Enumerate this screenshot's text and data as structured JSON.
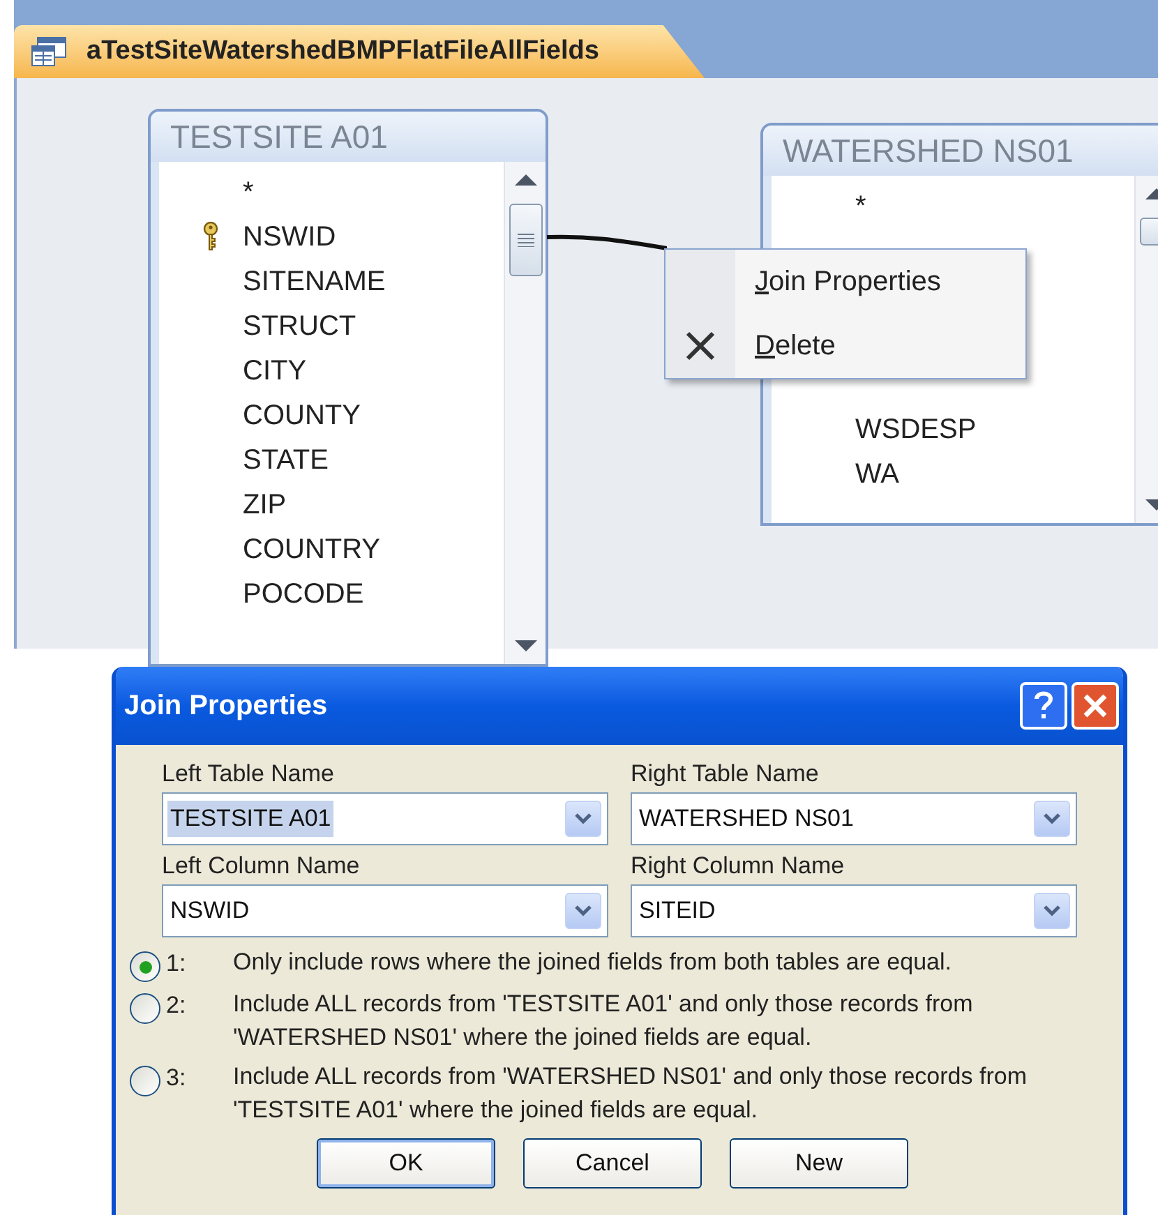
{
  "document_tab": {
    "title": "aTestSiteWatershedBMPFlatFileAllFields",
    "selected": true
  },
  "tables": [
    {
      "title": "TESTSITE A01",
      "fields": [
        {
          "name": "*",
          "kind": "all"
        },
        {
          "name": "NSWID",
          "kind": "key"
        },
        {
          "name": "SITENAME",
          "kind": "field"
        },
        {
          "name": "STRUCT",
          "kind": "field"
        },
        {
          "name": "CITY",
          "kind": "field"
        },
        {
          "name": "COUNTY",
          "kind": "field"
        },
        {
          "name": "STATE",
          "kind": "field"
        },
        {
          "name": "ZIP",
          "kind": "field"
        },
        {
          "name": "COUNTRY",
          "kind": "field"
        },
        {
          "name": "POCODE",
          "kind": "field"
        }
      ]
    },
    {
      "title": "WATERSHED NS01",
      "fields": [
        {
          "name": "*",
          "kind": "all"
        },
        {
          "kind": "covered"
        },
        {
          "kind": "covered"
        },
        {
          "kind": "covered"
        },
        {
          "kind": "covered"
        },
        {
          "name": "WSDESP",
          "kind": "field"
        },
        {
          "name": "WA",
          "kind": "field"
        }
      ]
    }
  ],
  "context_menu": {
    "items": [
      {
        "label": "Join Properties",
        "kind": "plain"
      },
      {
        "label": "Delete",
        "kind": "delete"
      }
    ]
  },
  "dialog": {
    "title": "Join Properties",
    "fields": [
      {
        "label": "Left Table Name",
        "value": "TESTSITE A01",
        "selected": true
      },
      {
        "label": "Right Table Name",
        "value": "WATERSHED NS01",
        "selected": false
      },
      {
        "label": "Left Column Name",
        "value": "NSWID",
        "selected": false
      },
      {
        "label": "Right Column Name",
        "value": "SITEID",
        "selected": false
      }
    ],
    "options": [
      {
        "number": "1:",
        "text": "Only include rows where the joined fields from both tables are equal.",
        "selected": true
      },
      {
        "number": "2:",
        "text": "Include ALL records from 'TESTSITE A01' and only those records from 'WATERSHED NS01' where the joined fields are equal.",
        "selected": false
      },
      {
        "number": "3:",
        "text": "Include ALL records from 'WATERSHED NS01' and only those records from 'TESTSITE A01' where the joined fields are equal.",
        "selected": false
      }
    ],
    "buttons": [
      {
        "label": "OK",
        "default": true
      },
      {
        "label": "Cancel",
        "default": false
      },
      {
        "label": "New",
        "default": false
      }
    ]
  }
}
